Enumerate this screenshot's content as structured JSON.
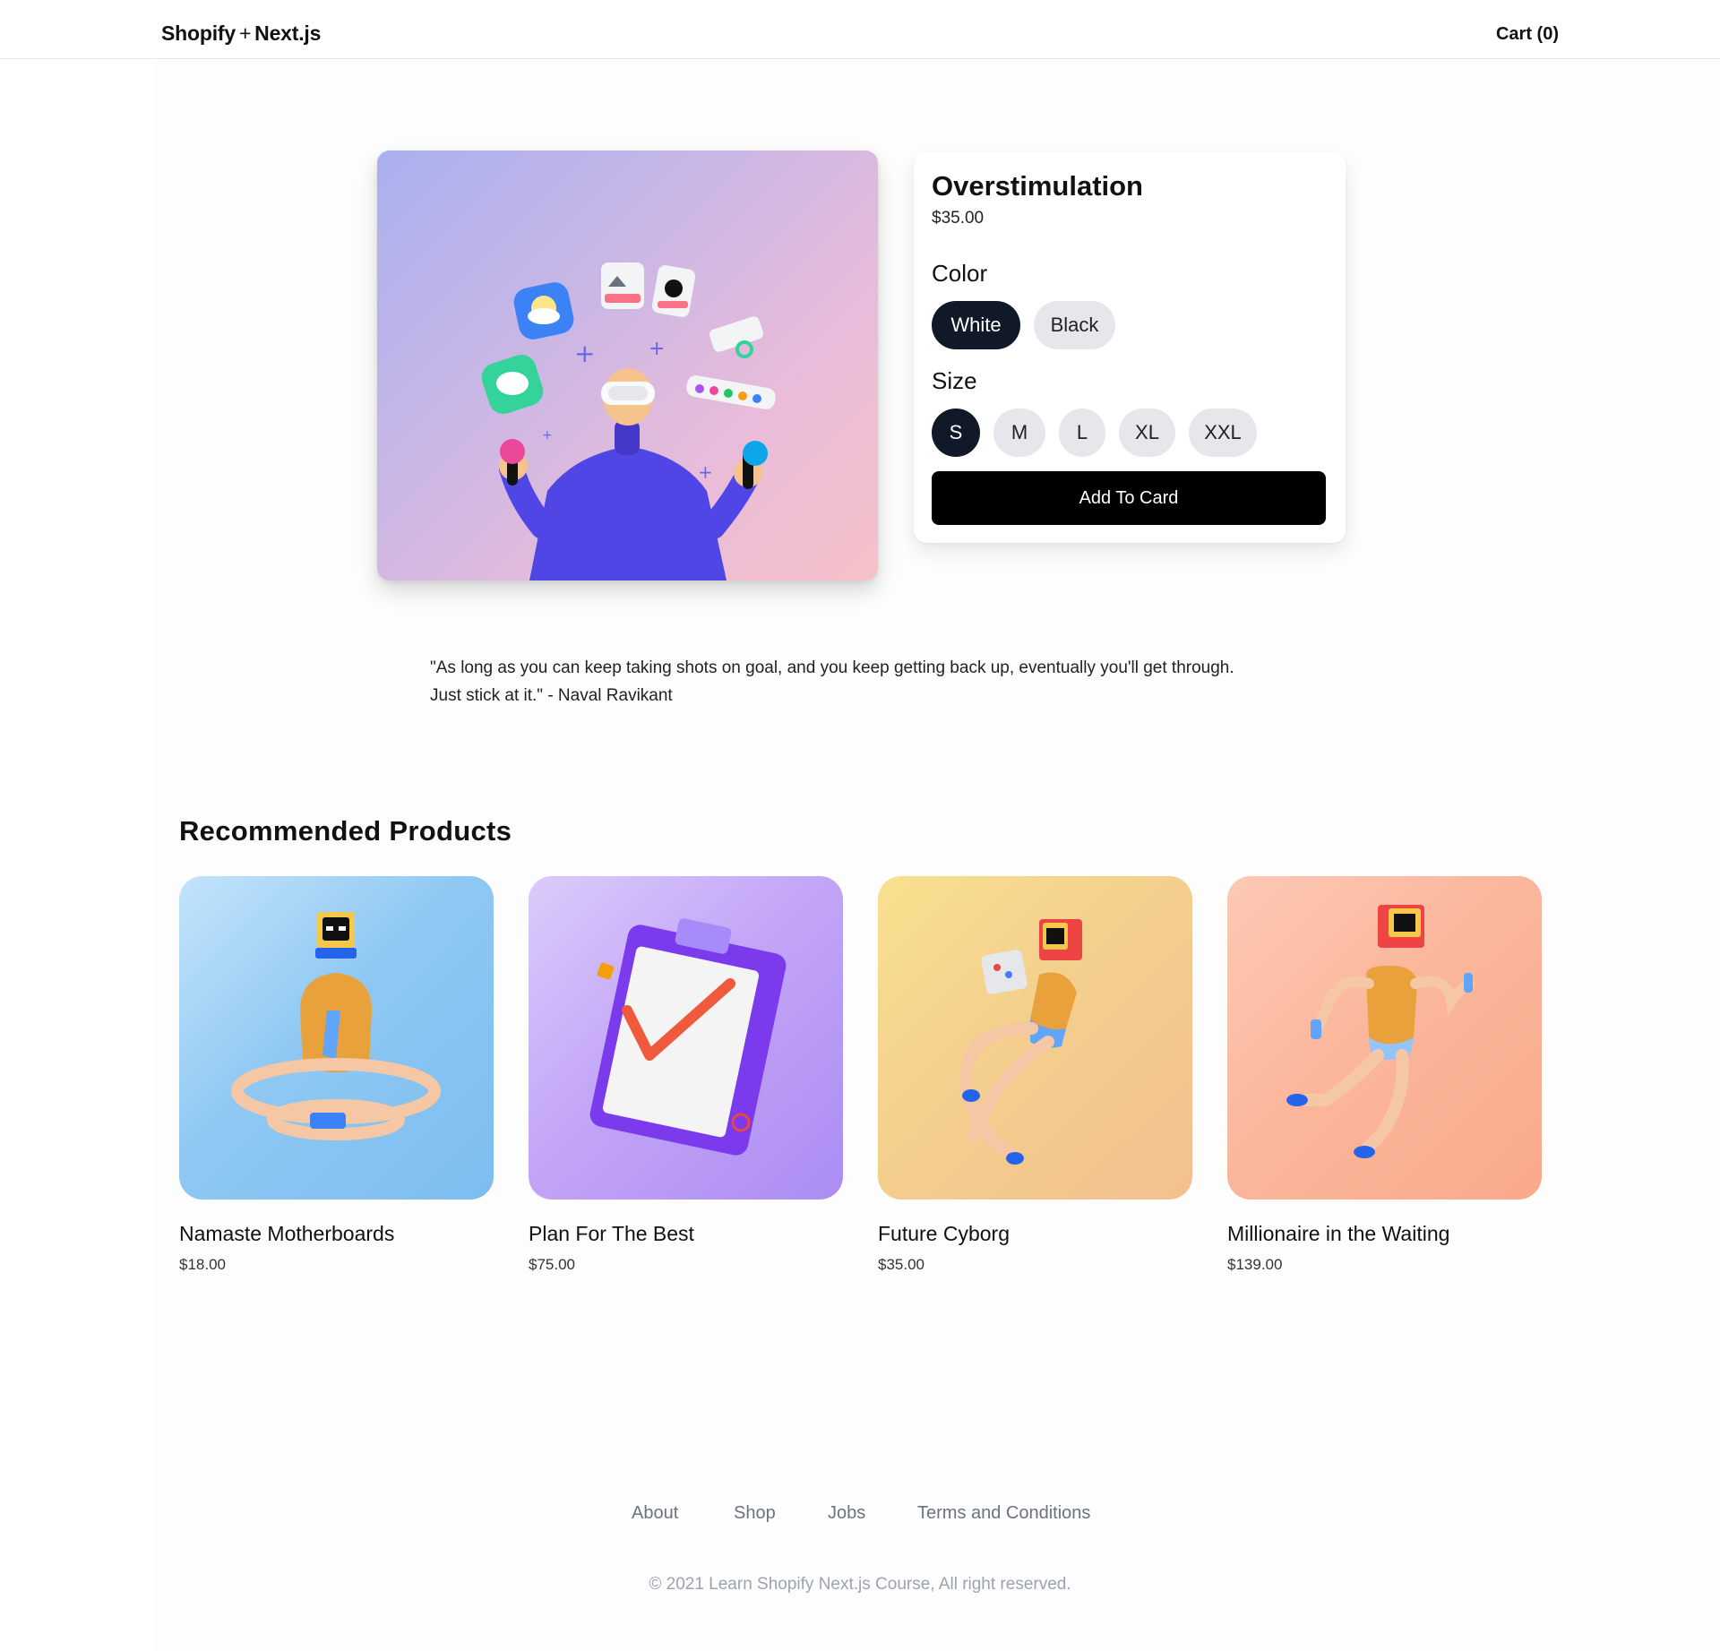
{
  "header": {
    "logo_left": "Shopify",
    "logo_plus": "+",
    "logo_right": "Next.js",
    "cart": "Cart (0)"
  },
  "product": {
    "title": "Overstimulation",
    "price": "$35.00",
    "color_label": "Color",
    "colors": [
      "White",
      "Black"
    ],
    "selected_color": "White",
    "size_label": "Size",
    "sizes": [
      "S",
      "M",
      "L",
      "XL",
      "XXL"
    ],
    "selected_size": "S",
    "add_button": "Add To Card"
  },
  "quote": {
    "line1": "\"As long as you can keep taking shots on goal, and you keep getting back up, eventually you'll get through.",
    "line2": "Just stick at it.\" - Naval Ravikant"
  },
  "recommended": {
    "title": "Recommended Products",
    "items": [
      {
        "name": "Namaste Motherboards",
        "price": "$18.00",
        "bg": "#8fc8f2"
      },
      {
        "name": "Plan For The Best",
        "price": "$75.00",
        "bg": "#c3a6f7"
      },
      {
        "name": "Future Cyborg",
        "price": "$35.00",
        "bg": "#f4cf8d"
      },
      {
        "name": "Millionaire in the Waiting",
        "price": "$139.00",
        "bg": "#fbb79c"
      }
    ]
  },
  "footer": {
    "links": [
      "About",
      "Shop",
      "Jobs",
      "Terms and Conditions"
    ],
    "copyright": "© 2021 Learn Shopify Next.js Course, All right reserved."
  }
}
